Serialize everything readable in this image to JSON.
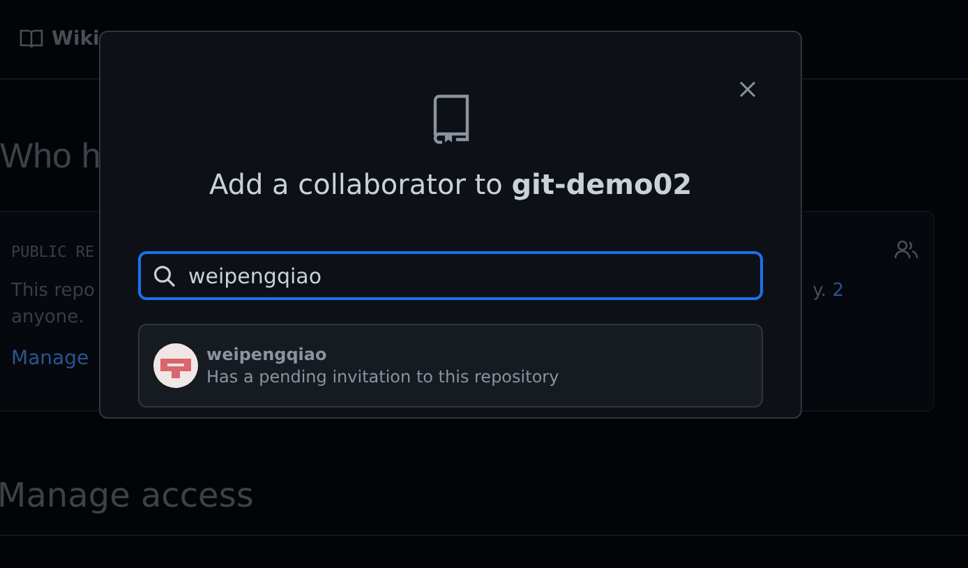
{
  "background": {
    "tab": "Wiki",
    "heading": "Who h",
    "card": {
      "label": "PUBLIC RE",
      "text_left": "This repo",
      "text_right": "y.",
      "link_count": "2",
      "text_line2": "anyone.",
      "link": "Manage"
    },
    "section_heading": "Manage access"
  },
  "dialog": {
    "title": "Add a collaborator to ",
    "repo": "git-demo02",
    "search": {
      "value": "weipengqiao"
    },
    "results": [
      {
        "username": "weipengqiao",
        "status": "Has a pending invitation to this repository"
      }
    ]
  }
}
